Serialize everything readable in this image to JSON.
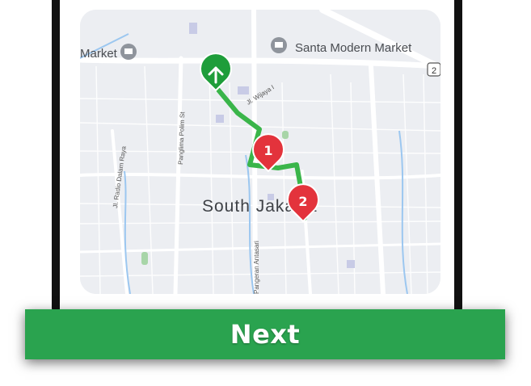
{
  "map": {
    "labels": {
      "market_left": "Market",
      "santa_market": "Santa Modern Market",
      "district": "South Jakarta",
      "street_wijaya": "Jl. Wijaya I",
      "street_polim": "Panglima Polim St",
      "street_radio": "Jl. Radio Dalam Raya",
      "street_antasari": "Pangeran Antasari",
      "road_badge": "2"
    },
    "route_color": "#3ab54a",
    "start_marker_color": "#1e9d3a",
    "stop_marker_color": "#e3333c",
    "stops": [
      {
        "label": "1"
      },
      {
        "label": "2"
      }
    ]
  },
  "footer": {
    "next_label": "Next",
    "button_color": "#2aa34f"
  }
}
